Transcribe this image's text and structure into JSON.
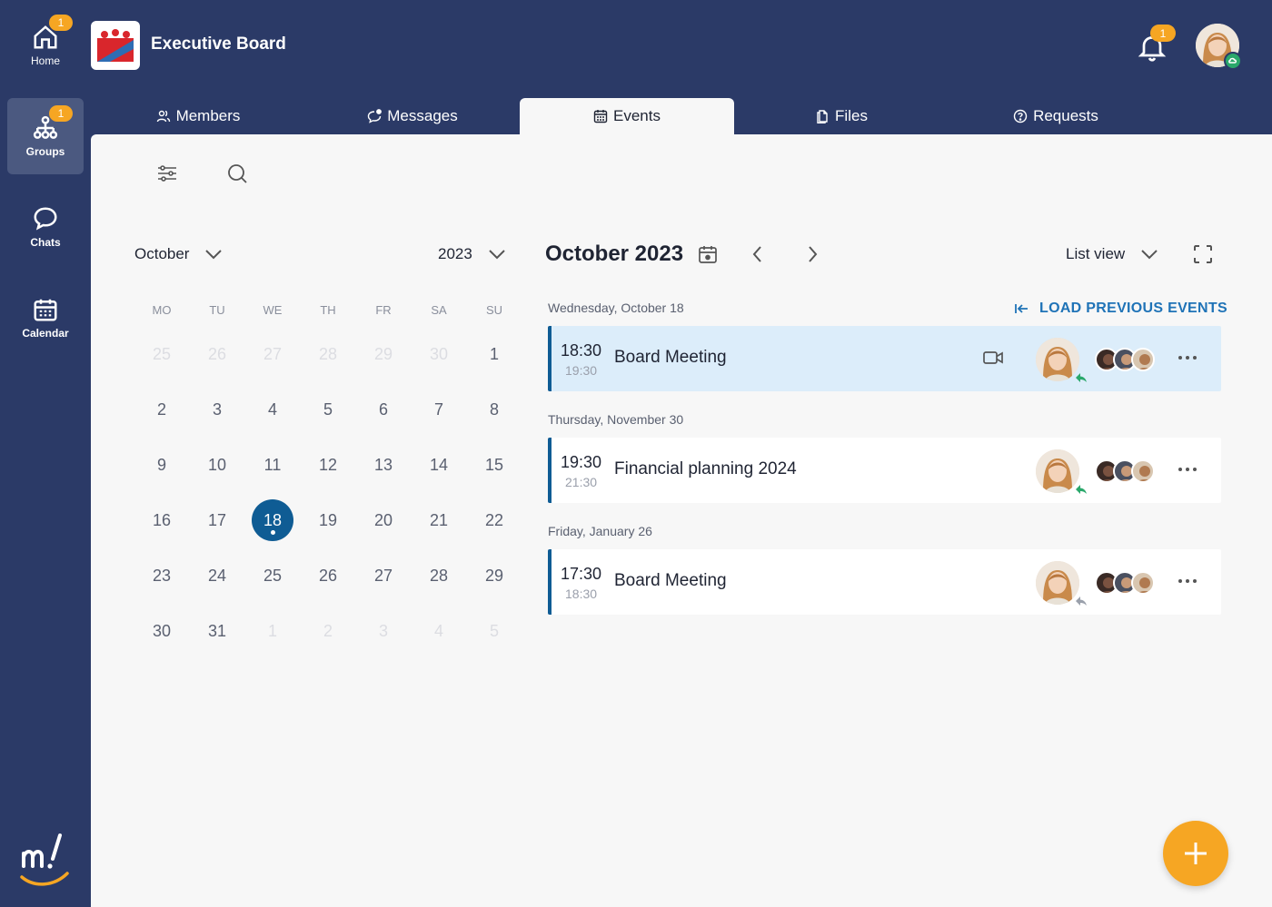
{
  "rail": {
    "items": [
      {
        "label": "Home",
        "badge": "1"
      },
      {
        "label": "Groups",
        "badge": "1"
      },
      {
        "label": "Chats"
      },
      {
        "label": "Calendar"
      }
    ]
  },
  "header": {
    "group_title": "Executive Board",
    "notifications_badge": "1"
  },
  "tabs": [
    {
      "label": "Members"
    },
    {
      "label": "Messages"
    },
    {
      "label": "Events"
    },
    {
      "label": "Files"
    },
    {
      "label": "Requests"
    }
  ],
  "mini_calendar": {
    "month": "October",
    "year": "2023",
    "weekdays": [
      "MO",
      "TU",
      "WE",
      "TH",
      "FR",
      "SA",
      "SU"
    ],
    "weeks": [
      [
        "25",
        "26",
        "27",
        "28",
        "29",
        "30",
        "1"
      ],
      [
        "2",
        "3",
        "4",
        "5",
        "6",
        "7",
        "8"
      ],
      [
        "9",
        "10",
        "11",
        "12",
        "13",
        "14",
        "15"
      ],
      [
        "16",
        "17",
        "18",
        "19",
        "20",
        "21",
        "22"
      ],
      [
        "23",
        "24",
        "25",
        "26",
        "27",
        "28",
        "29"
      ],
      [
        "30",
        "31",
        "1",
        "2",
        "3",
        "4",
        "5"
      ]
    ],
    "selected_day": "18"
  },
  "events_panel": {
    "title": "October 2023",
    "view_mode": "List view",
    "load_previous": "LOAD PREVIOUS EVENTS",
    "groups": [
      {
        "day": "Wednesday, October 18",
        "event": {
          "start": "18:30",
          "end": "19:30",
          "name": "Board Meeting",
          "video": true,
          "highlight": true
        }
      },
      {
        "day": "Thursday, November 30",
        "event": {
          "start": "19:30",
          "end": "21:30",
          "name": "Financial planning 2024",
          "video": false,
          "highlight": false
        }
      },
      {
        "day": "Friday, January 26",
        "event": {
          "start": "17:30",
          "end": "18:30",
          "name": "Board Meeting",
          "video": false,
          "highlight": false
        }
      }
    ]
  },
  "colors": {
    "sidebar": "#2b3a67",
    "accent": "#0f5c94",
    "badge": "#f6a623",
    "link": "#1f73b7",
    "highlight_card": "#dcedfa"
  }
}
